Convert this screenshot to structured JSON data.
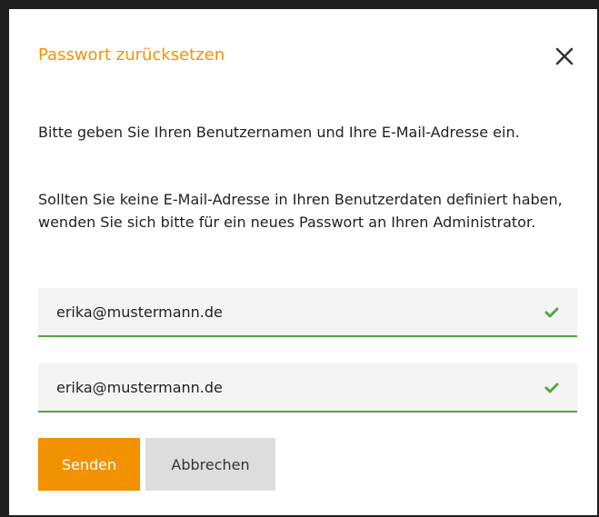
{
  "dialog": {
    "title": "Passwort zurücksetzen",
    "close_icon": "close-icon",
    "paragraph1": "Bitte geben Sie Ihren Benutzernamen und Ihre E-Mail-Adresse ein.",
    "paragraph2": "Sollten Sie keine E-Mail-Adresse in Ihren Benutzerdaten definiert haben, wenden Sie sich bitte für ein neues Passwort an Ihren Administrator."
  },
  "form": {
    "username_value": "erika@mustermann.de",
    "email_value": "erika@mustermann.de",
    "valid_icon": "checkmark-icon"
  },
  "buttons": {
    "send_label": "Senden",
    "cancel_label": "Abbrechen"
  },
  "colors": {
    "accent": "#f39200",
    "valid": "#55a544",
    "cancel_bg": "#dddddd"
  }
}
